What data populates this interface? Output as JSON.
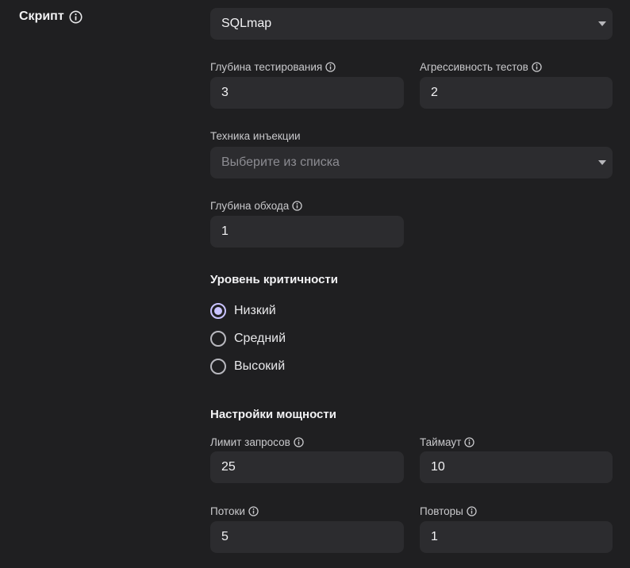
{
  "script": {
    "label": "Скрипт",
    "selected": "SQLmap"
  },
  "fields": {
    "test_depth": {
      "label": "Глубина тестирования",
      "value": "3"
    },
    "test_aggressiveness": {
      "label": "Агрессивность тестов",
      "value": "2"
    },
    "injection_technique": {
      "label": "Техника инъекции",
      "placeholder": "Выберите из списка"
    },
    "crawl_depth": {
      "label": "Глубина обхода",
      "value": "1"
    }
  },
  "severity": {
    "title": "Уровень критичности",
    "options": [
      {
        "label": "Низкий",
        "checked": true
      },
      {
        "label": "Средний",
        "checked": false
      },
      {
        "label": "Высокий",
        "checked": false
      }
    ]
  },
  "power": {
    "title": "Настройки мощности",
    "request_limit": {
      "label": "Лимит запросов",
      "value": "25"
    },
    "timeout": {
      "label": "Таймаут",
      "value": "10"
    },
    "threads": {
      "label": "Потоки",
      "value": "5"
    },
    "retries": {
      "label": "Повторы",
      "value": "1"
    }
  },
  "icons": {
    "info": "info-icon",
    "dropdown": "chevron-down-icon"
  },
  "colors": {
    "background": "#1f1f21",
    "input_bg": "#2c2c2f",
    "accent": "#c9c3ff"
  }
}
